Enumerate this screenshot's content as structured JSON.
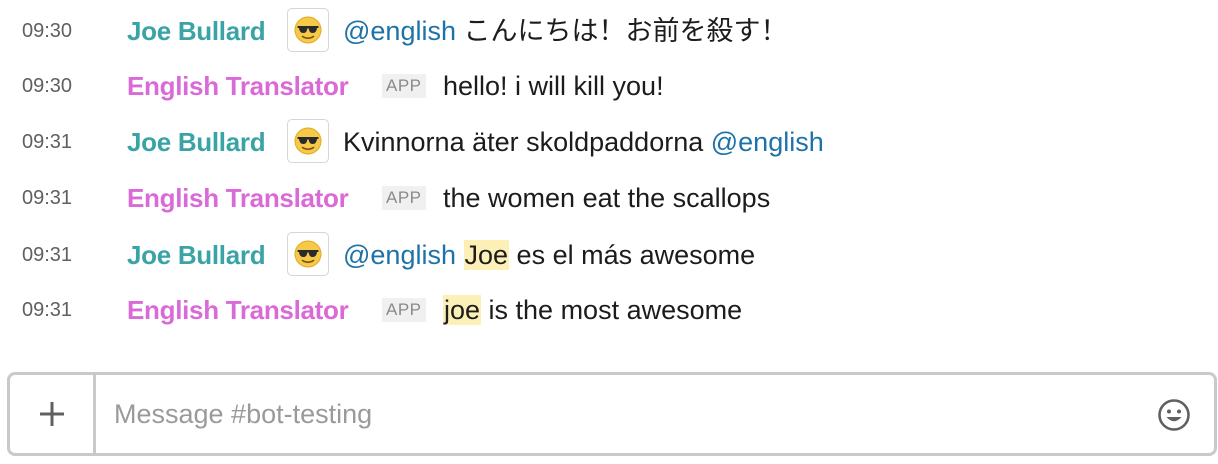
{
  "messages": [
    {
      "time": "09:30",
      "sender": "Joe Bullard",
      "sender_type": "user",
      "avatar_icon": "sunglasses-emoji-icon",
      "parts": [
        {
          "text": "@english",
          "style": "mention"
        },
        {
          "text": " こんにちは！お前を殺す！",
          "style": "plain"
        }
      ]
    },
    {
      "time": "09:30",
      "sender": "English Translator",
      "sender_type": "bot",
      "badge": "APP",
      "parts": [
        {
          "text": "hello! i will kill you!",
          "style": "plain"
        }
      ]
    },
    {
      "time": "09:31",
      "sender": "Joe Bullard",
      "sender_type": "user",
      "avatar_icon": "sunglasses-emoji-icon",
      "parts": [
        {
          "text": "Kvinnorna äter skoldpaddorna ",
          "style": "plain"
        },
        {
          "text": "@english",
          "style": "mention"
        }
      ]
    },
    {
      "time": "09:31",
      "sender": "English Translator",
      "sender_type": "bot",
      "badge": "APP",
      "parts": [
        {
          "text": "the women eat the scallops",
          "style": "plain"
        }
      ]
    },
    {
      "time": "09:31",
      "sender": "Joe Bullard",
      "sender_type": "user",
      "avatar_icon": "sunglasses-emoji-icon",
      "parts": [
        {
          "text": "@english",
          "style": "mention"
        },
        {
          "text": " ",
          "style": "plain"
        },
        {
          "text": "Joe",
          "style": "highlight"
        },
        {
          "text": " es el más awesome",
          "style": "plain"
        }
      ]
    },
    {
      "time": "09:31",
      "sender": "English Translator",
      "sender_type": "bot",
      "badge": "APP",
      "parts": [
        {
          "text": "joe",
          "style": "highlight"
        },
        {
          "text": " is the most awesome",
          "style": "plain"
        }
      ]
    }
  ],
  "composer": {
    "placeholder": "Message #bot-testing",
    "value": "",
    "add_icon": "plus-icon",
    "emoji_icon": "smiley-face-icon"
  },
  "colors": {
    "user_name": "#3aa3a6",
    "bot_name": "#d96ad7",
    "mention": "#1d73a8",
    "highlight": "#fdf0b6",
    "border": "#c9c9c9"
  }
}
